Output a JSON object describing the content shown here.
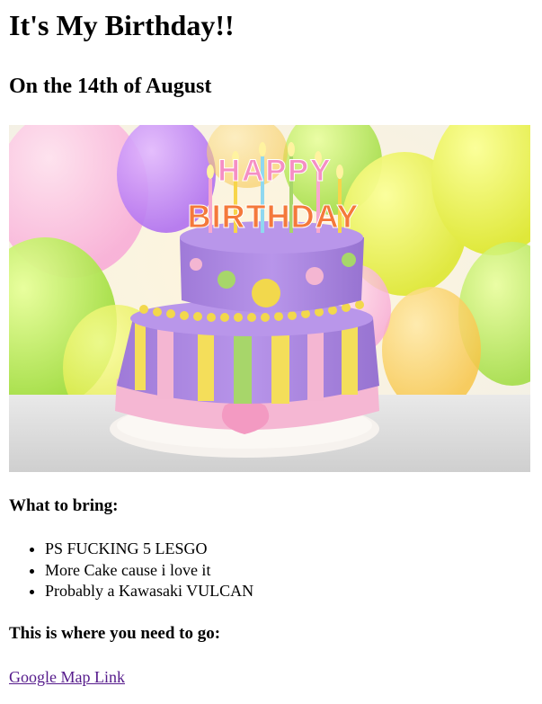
{
  "page": {
    "title": "It's My Birthday!!",
    "subtitle": "On the 14th of August"
  },
  "hero_image": {
    "cake_topper_line1": "HAPPY",
    "cake_topper_line2": "BIRTHDAY"
  },
  "bring": {
    "heading": "What to bring:",
    "items": [
      "PS FUCKING 5 LESGO",
      "More Cake cause i love it",
      "Probably a Kawasaki VULCAN"
    ]
  },
  "location": {
    "heading": "This is where you need to go:",
    "link_label": "Google Map Link"
  },
  "colors": {
    "link_visited": "#551a8b",
    "text": "#000000",
    "background": "#ffffff"
  }
}
